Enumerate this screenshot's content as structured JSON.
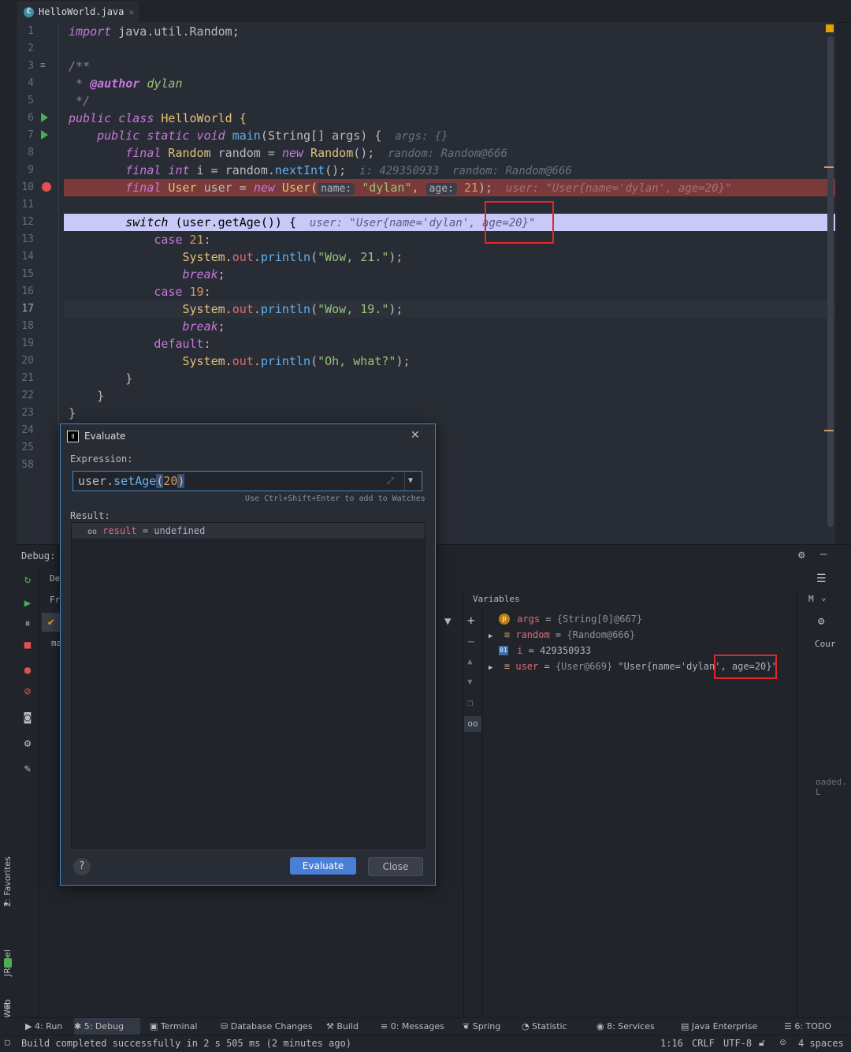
{
  "tab": {
    "filename": "HelloWorld.java"
  },
  "editor": {
    "line_numbers": [
      "1",
      "2",
      "3",
      "4",
      "5",
      "6",
      "7",
      "8",
      "9",
      "10",
      "11",
      "12",
      "13",
      "14",
      "15",
      "16",
      "17",
      "18",
      "19",
      "20",
      "21",
      "22",
      "23",
      "24",
      "25",
      "58"
    ],
    "code": {
      "l1_kw": "import",
      "l1_rest": " java.util.Random;",
      "l3": "/**",
      "l4_star": " * ",
      "l4_tag": "@author",
      "l4_name": " dylan",
      "l5": " */",
      "l6_a": "public class",
      "l6_b": " HelloWorld {",
      "l7_a": "    public static void",
      "l7_fn": " main",
      "l7_b": "(String[] args) {",
      "l7_inl": "  args: {}",
      "l8_a": "        final",
      "l8_ty": " Random",
      "l8_b": " random = ",
      "l8_new": "new",
      "l8_ty2": " Random",
      "l8_c": "();",
      "l8_inl": "  random: Random@666",
      "l9_a": "        final",
      "l9_int": " int",
      "l9_b": " i = random.",
      "l9_fn": "nextInt",
      "l9_c": "();",
      "l9_inl": "  i: 429350933  random: Random@666",
      "l10_a": "        final",
      "l10_ty": " User",
      "l10_b": " user = ",
      "l10_new": "new",
      "l10_ty2": " User(",
      "l10_hint1": "name:",
      "l10_str": " \"dylan\"",
      "l10_c": ", ",
      "l10_hint2": "age:",
      "l10_num": " 21",
      "l10_d": ");",
      "l10_inl": "  user: \"User{name='dylan', age=20}\"",
      "l12_a": "        switch",
      "l12_b": " (user.getAge()) {",
      "l12_inl": "  user: \"User{name='dylan', age=20}\"",
      "l13_a": "            case",
      "l13_num": " 21",
      "l13_b": ":",
      "l14_a": "                System.",
      "l14_fld": "out",
      "l14_b": ".",
      "l14_fn": "println",
      "l14_c": "(",
      "l14_str": "\"Wow, 21.\"",
      "l14_d": ");",
      "l15_a": "                break",
      "l15_b": ";",
      "l16_a": "            case",
      "l16_num": " 19",
      "l16_b": ":",
      "l17_a": "                System.",
      "l17_fld": "out",
      "l17_b": ".",
      "l17_fn": "println",
      "l17_c": "(",
      "l17_str": "\"Wow, 19.\"",
      "l17_d": ");",
      "l18_a": "                break",
      "l18_b": ";",
      "l19_a": "            default",
      "l19_b": ":",
      "l20_a": "                System.",
      "l20_fld": "out",
      "l20_b": ".",
      "l20_fn": "println",
      "l20_c": "(",
      "l20_str": "\"Oh, what?\"",
      "l20_d": ");",
      "l21": "        }",
      "l22": "    }",
      "l23": "}"
    }
  },
  "debug": {
    "title": "Debug:",
    "tab_fragment": "De",
    "frames_fragment": "Fr",
    "frame_item_fragment": "ma",
    "variables_header": "Variables",
    "right_header_fragment": "M",
    "right_col_fragment": "Cour",
    "loaded_fragment": "oaded. L",
    "variables": [
      {
        "name": "args",
        "eq": " = ",
        "value": "{String[0]@667}"
      },
      {
        "name": "random",
        "eq": " = ",
        "value": "{Random@666}"
      },
      {
        "name": "i",
        "eq": " = ",
        "value": "429350933"
      },
      {
        "name": "user",
        "eq": " = ",
        "value": "{User@669} ",
        "string": "\"User{name='dylan', age=20}\""
      }
    ]
  },
  "evaluate_dialog": {
    "title": "Evaluate",
    "expression_label": "Expression:",
    "expr_obj": "user.",
    "expr_fn": "setAge",
    "expr_open": "(",
    "expr_num": "20",
    "expr_close": ")",
    "watch_hint": "Use Ctrl+Shift+Enter to add to Watches",
    "result_label": "Result:",
    "result_name": "result",
    "result_eq": " = ",
    "result_value": "undefined",
    "help": "?",
    "evaluate_button": "Evaluate",
    "close_button": "Close"
  },
  "left_stripe": {
    "favorites": "2: Favorites",
    "jrebel": "JRebel",
    "web": "Web"
  },
  "tool_windows": [
    {
      "label": "4: Run"
    },
    {
      "label": "5: Debug"
    },
    {
      "label": "Terminal"
    },
    {
      "label": "Database Changes"
    },
    {
      "label": "Build"
    },
    {
      "label": "0: Messages"
    },
    {
      "label": "Spring"
    },
    {
      "label": "Statistic"
    },
    {
      "label": "8: Services"
    },
    {
      "label": "Java Enterprise"
    },
    {
      "label": "6: TODO"
    }
  ],
  "status": {
    "message": "Build completed successfully in 2 s 505 ms (2 minutes ago)",
    "position": "1:16",
    "line_sep": "CRLF",
    "encoding": "UTF-8",
    "indent": "4 spaces"
  },
  "colors": {
    "accent": "#3e88c6",
    "breakpoint_line": "#7a3a3a",
    "exec_line": "#c9c9f7",
    "highlight_box": "#e0262a"
  }
}
